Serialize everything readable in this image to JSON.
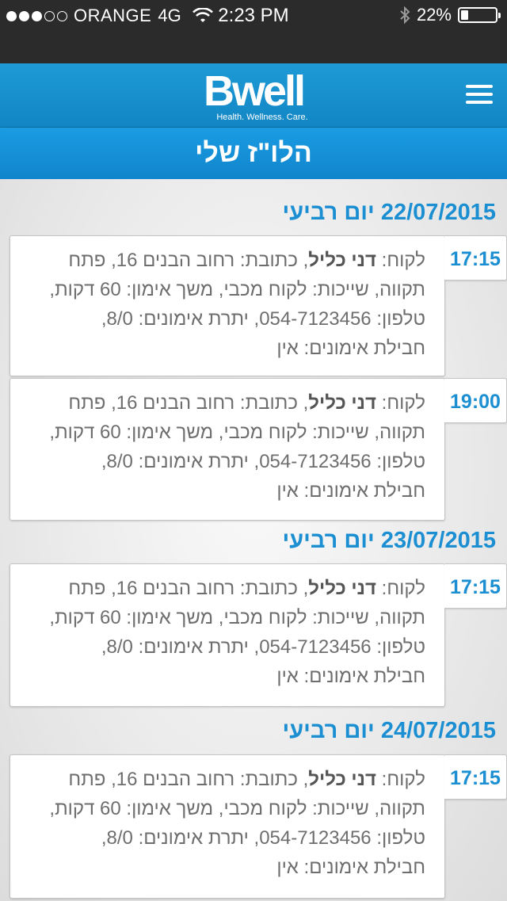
{
  "status": {
    "carrier": "ORANGE",
    "network": "4G",
    "time": "2:23 PM",
    "battery": "22%",
    "signal_bars": 3,
    "signal_total": 5
  },
  "header": {
    "logo": "Bwell",
    "tagline": "Health. Wellness. Care.",
    "menu_icon": "hamburger-menu-icon"
  },
  "page": {
    "title": "הלו\"ז שלי"
  },
  "colors": {
    "header_blue": "#1a9ce3",
    "accent_text": "#1b8fd2",
    "status_bar": "#2b2b2b"
  },
  "schedule": [
    {
      "date": "22/07/2015",
      "day": "יום רביעי",
      "appointments": [
        {
          "time": "17:15",
          "client_label": "לקוח:",
          "client_name": "דני כליל",
          "line1_rest": ", כתובת: רחוב הבנים 16, פתח",
          "line2": "תקווה, שייכות: לקוח מכבי, משך אימון: 60 דקות,",
          "line3": "טלפון: 054-7123456, יתרת אימונים: 8/0,",
          "line4": "חבילת אימונים: אין"
        },
        {
          "time": "19:00",
          "client_label": "לקוח:",
          "client_name": "דני כליל",
          "line1_rest": ", כתובת: רחוב הבנים 16, פתח",
          "line2": "תקווה, שייכות: לקוח מכבי, משך אימון: 60 דקות,",
          "line3": "טלפון: 054-7123456, יתרת אימונים: 8/0,",
          "line4": "חבילת אימונים: אין"
        }
      ]
    },
    {
      "date": "23/07/2015",
      "day": "יום רביעי",
      "appointments": [
        {
          "time": "17:15",
          "client_label": "לקוח:",
          "client_name": "דני כליל",
          "line1_rest": ", כתובת: רחוב הבנים 16, פתח",
          "line2": "תקווה, שייכות: לקוח מכבי, משך אימון: 60 דקות,",
          "line3": "טלפון: 054-7123456, יתרת אימונים: 8/0,",
          "line4": "חבילת אימונים: אין"
        }
      ]
    },
    {
      "date": "24/07/2015",
      "day": "יום רביעי",
      "appointments": [
        {
          "time": "17:15",
          "client_label": "לקוח:",
          "client_name": "דני כליל",
          "line1_rest": ", כתובת: רחוב הבנים 16, פתח",
          "line2": "תקווה, שייכות: לקוח מכבי, משך אימון: 60 דקות,",
          "line3": "טלפון: 054-7123456, יתרת אימונים: 8/0,",
          "line4": "חבילת אימונים: אין"
        }
      ]
    }
  ]
}
